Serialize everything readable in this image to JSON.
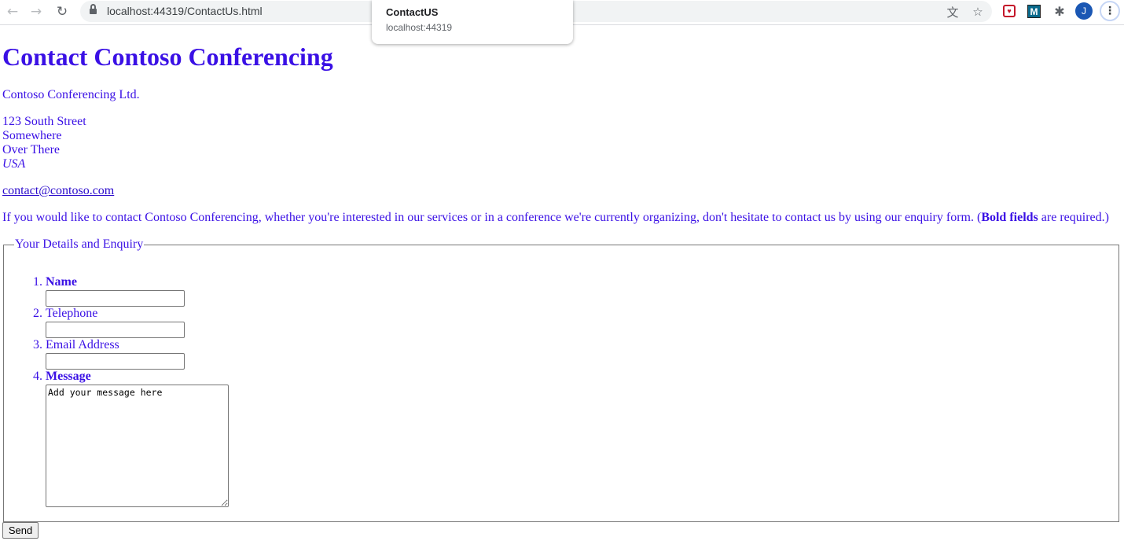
{
  "browser": {
    "url": "localhost:44319/ContactUs.html",
    "back_icon": "←",
    "forward_icon": "→",
    "reload_icon": "↻",
    "translate_icon": "文",
    "star_icon": "☆",
    "pocket_label": "♥",
    "m_ext_label": "M",
    "puzzle_icon": "✱",
    "avatar_letter": "J",
    "menu_icon": "⋮"
  },
  "hover_card": {
    "title": "ContactUS",
    "url": "localhost:44319"
  },
  "page": {
    "heading": "Contact Contoso Conferencing",
    "company": "Contoso Conferencing Ltd.",
    "address": {
      "line1": "123 South Street",
      "line2": "Somewhere",
      "line3": "Over There",
      "country": "USA"
    },
    "email": "contact@contoso.com",
    "intro_start": "If you would like to contact Contoso Conferencing, whether you're interested in our services or in a conference we're currently organizing, don't hesitate to contact us by using our enquiry form. (",
    "intro_bold": "Bold fields",
    "intro_end": " are required.)"
  },
  "form": {
    "legend": "Your Details and Enquiry",
    "fields": [
      {
        "label": "Name",
        "required": true,
        "value": ""
      },
      {
        "label": "Telephone",
        "required": false,
        "value": ""
      },
      {
        "label": "Email Address",
        "required": false,
        "value": ""
      },
      {
        "label": "Message",
        "required": true,
        "value": "Add your message here"
      }
    ],
    "send_label": "Send"
  },
  "colors": {
    "text": "#3a10e5",
    "link": "#2a0acc"
  }
}
